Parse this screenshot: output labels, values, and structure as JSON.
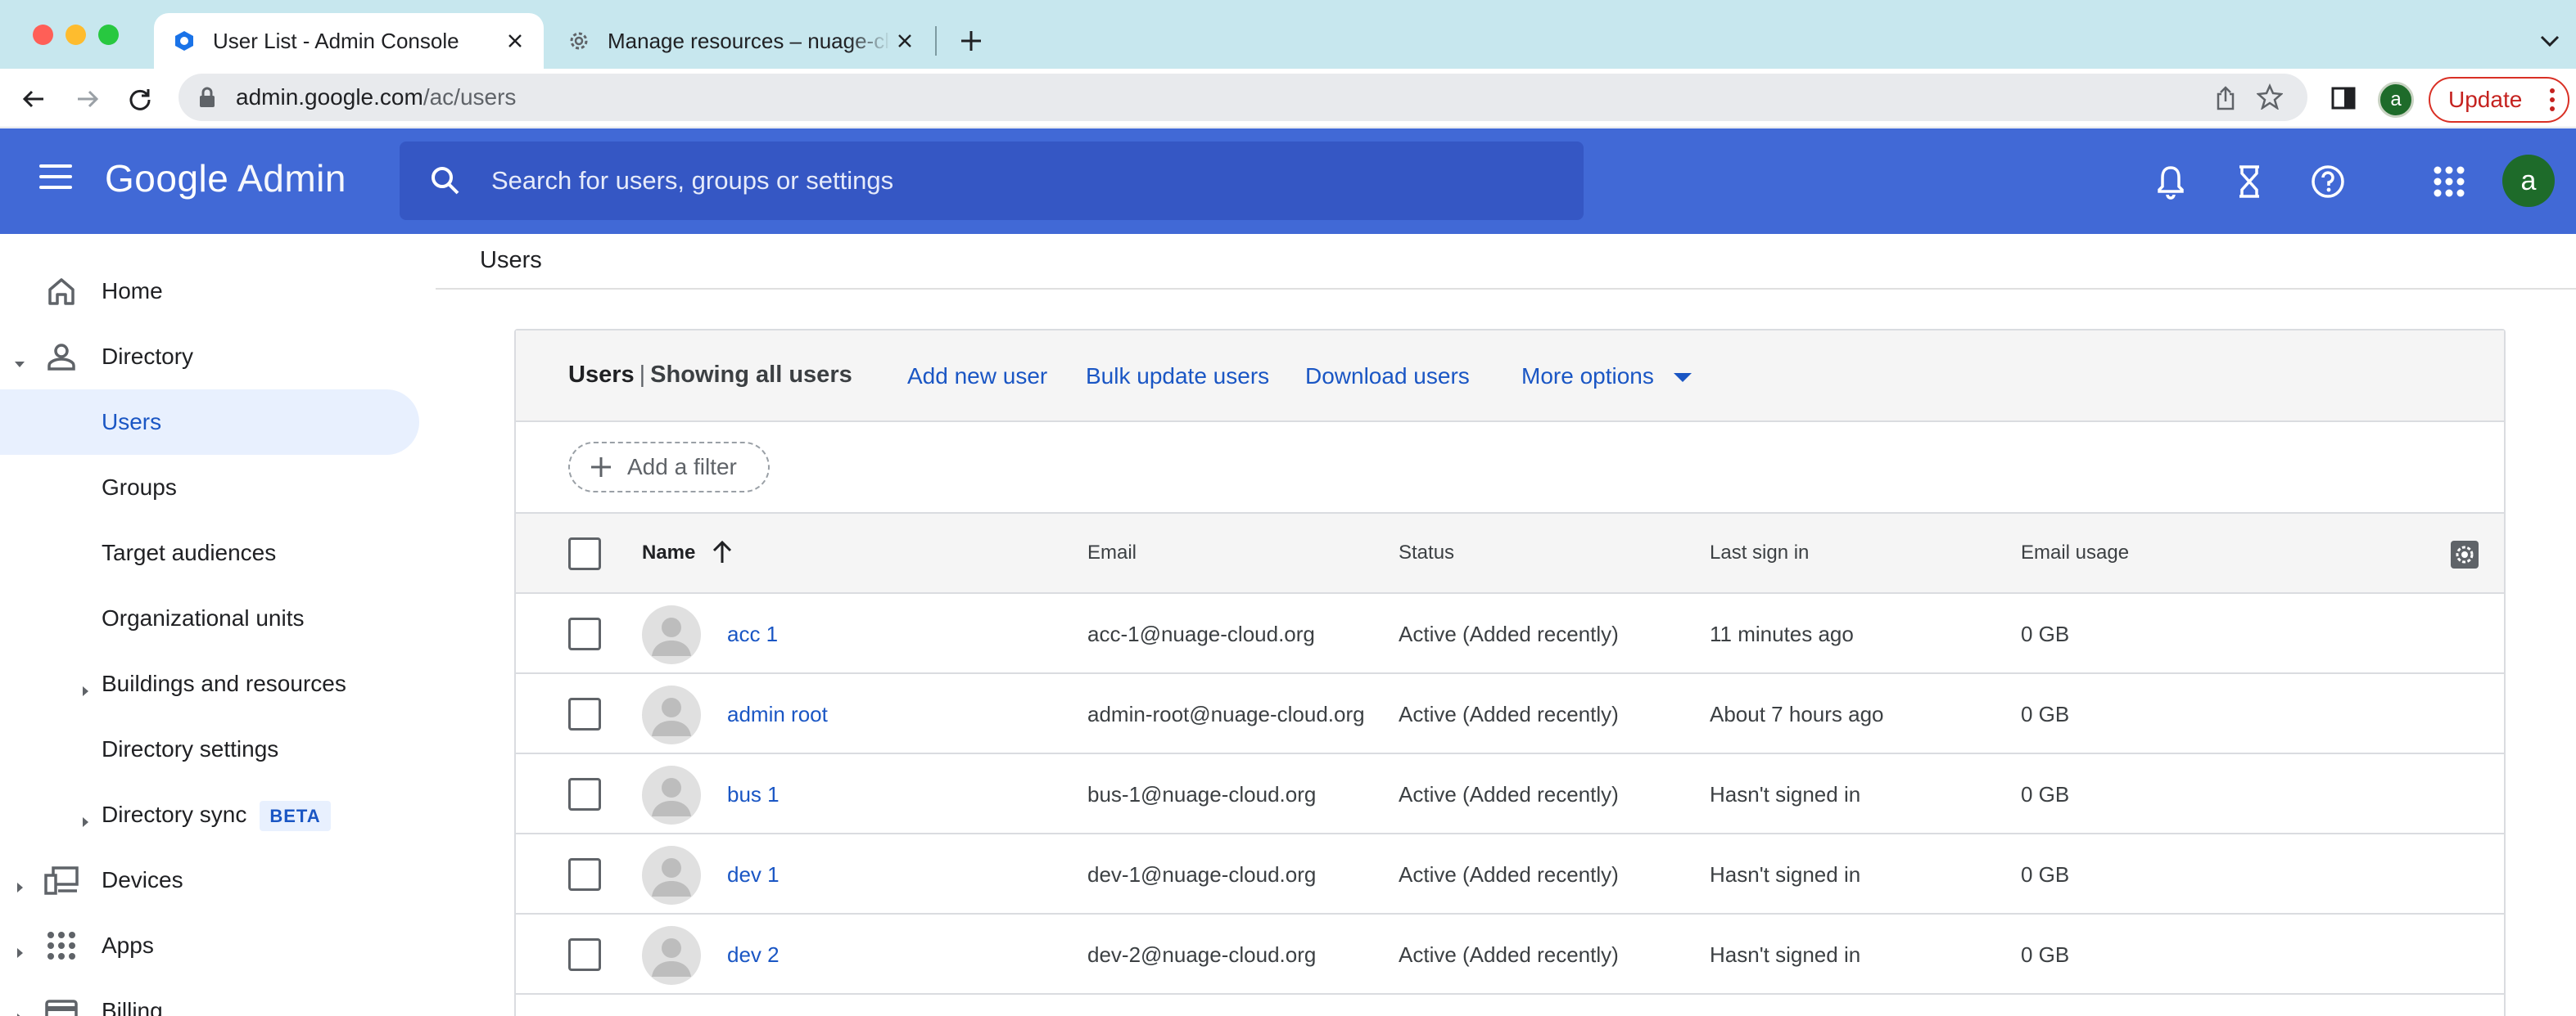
{
  "browser": {
    "tabs": [
      {
        "title": "User List - Admin Console",
        "active": true
      },
      {
        "title": "Manage resources – nuage-cloud",
        "active": false
      }
    ],
    "url_host": "admin.google.com",
    "url_path": "/ac/users",
    "profile_initial": "a",
    "update_label": "Update"
  },
  "header": {
    "brand_google": "Google",
    "brand_admin": "Admin",
    "search_placeholder": "Search for users, groups or settings",
    "avatar_initial": "a"
  },
  "sidebar": {
    "items": [
      {
        "label": "Home",
        "icon": "home-icon"
      },
      {
        "label": "Directory",
        "icon": "person-icon"
      },
      {
        "label": "Users"
      },
      {
        "label": "Groups"
      },
      {
        "label": "Target audiences"
      },
      {
        "label": "Organizational units"
      },
      {
        "label": "Buildings and resources"
      },
      {
        "label": "Directory settings"
      },
      {
        "label": "Directory sync",
        "badge": "BETA"
      },
      {
        "label": "Devices",
        "icon": "devices-icon"
      },
      {
        "label": "Apps",
        "icon": "apps-grid-icon"
      },
      {
        "label": "Billing",
        "icon": "billing-icon"
      }
    ]
  },
  "breadcrumb": "Users",
  "card": {
    "title": "Users",
    "subtitle": "Showing all users",
    "actions": [
      "Add new user",
      "Bulk update users",
      "Download users",
      "More options"
    ],
    "filter_label": "Add a filter"
  },
  "table": {
    "columns": [
      "Name",
      "Email",
      "Status",
      "Last sign in",
      "Email usage"
    ],
    "rows": [
      {
        "name": "acc 1",
        "email": "acc-1@nuage-cloud.org",
        "status": "Active (Added recently)",
        "last_sign_in": "11 minutes ago",
        "usage": "0 GB"
      },
      {
        "name": "admin root",
        "email": "admin-root@nuage-cloud.org",
        "status": "Active (Added recently)",
        "last_sign_in": "About 7 hours ago",
        "usage": "0 GB"
      },
      {
        "name": "bus 1",
        "email": "bus-1@nuage-cloud.org",
        "status": "Active (Added recently)",
        "last_sign_in": "Hasn't signed in",
        "usage": "0 GB"
      },
      {
        "name": "dev 1",
        "email": "dev-1@nuage-cloud.org",
        "status": "Active (Added recently)",
        "last_sign_in": "Hasn't signed in",
        "usage": "0 GB"
      },
      {
        "name": "dev 2",
        "email": "dev-2@nuage-cloud.org",
        "status": "Active (Added recently)",
        "last_sign_in": "Hasn't signed in",
        "usage": "0 GB"
      }
    ]
  },
  "colors": {
    "app_bar": "#4169d6",
    "link": "#1a56c4",
    "selected_nav_bg": "#e8f0fe",
    "tab_strip": "#c7e7ee"
  }
}
